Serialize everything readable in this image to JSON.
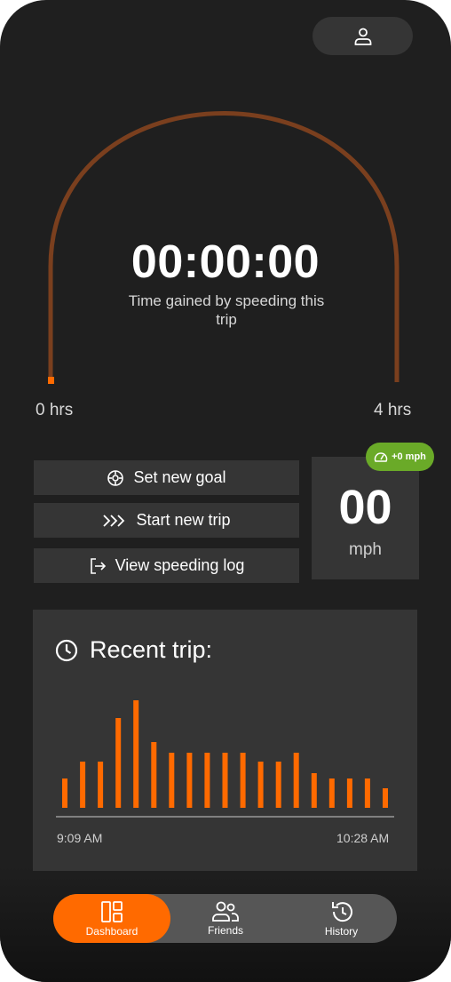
{
  "colors": {
    "accent": "#ff6a00",
    "card": "#353535",
    "badge": "#6aaa28",
    "arc": "#7a3f1e"
  },
  "header": {
    "profile_icon": "user-icon"
  },
  "gauge": {
    "timer": "00:00:00",
    "caption": "Time gained by speeding this trip",
    "min_label": "0 hrs",
    "max_label": "4 hrs",
    "progress_fraction": 0
  },
  "actions": [
    {
      "label": "Set new goal",
      "icon": "target-icon"
    },
    {
      "label": "Start new trip",
      "icon": "chevrons-right-icon"
    },
    {
      "label": "View speeding log",
      "icon": "logout-icon"
    }
  ],
  "speed": {
    "value": "00",
    "unit": "mph",
    "delta": "+0 mph",
    "icon": "speedometer-icon"
  },
  "recent": {
    "title": "Recent trip:",
    "start_time": "9:09 AM",
    "end_time": "10:28 AM"
  },
  "chart_data": {
    "type": "bar",
    "title": "Recent trip:",
    "x_start": "9:09 AM",
    "x_end": "10:28 AM",
    "values": [
      33,
      52,
      52,
      101,
      121,
      74,
      62,
      62,
      62,
      62,
      62,
      52,
      52,
      62,
      39,
      33,
      33,
      33,
      22
    ],
    "ylim": [
      0,
      130
    ],
    "grid": false
  },
  "tabs": [
    {
      "label": "Dashboard",
      "icon": "dashboard-icon",
      "active": true
    },
    {
      "label": "Friends",
      "icon": "friends-icon",
      "active": false
    },
    {
      "label": "History",
      "icon": "history-icon",
      "active": false
    }
  ]
}
